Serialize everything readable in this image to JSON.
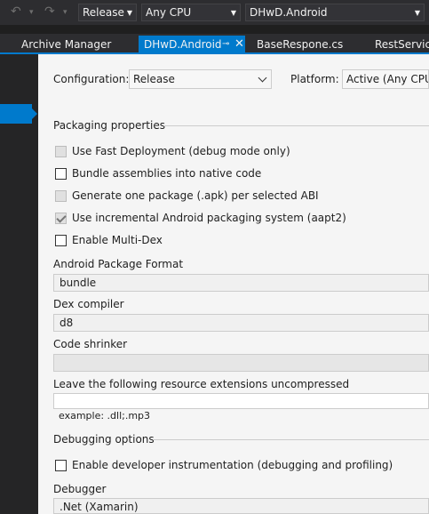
{
  "toolbar": {
    "configuration": "Release",
    "platform": "Any CPU",
    "project": "DHwD.Android"
  },
  "tabs": [
    {
      "label": "Archive Manager"
    },
    {
      "label": "DHwD.Android"
    },
    {
      "label": "BaseRespone.cs"
    },
    {
      "label": "RestService.c"
    }
  ],
  "config": {
    "configuration_label": "Configuration:",
    "configuration_value": "Release",
    "platform_label": "Platform:",
    "platform_value": "Active (Any CPU)"
  },
  "packaging": {
    "title": "Packaging properties",
    "options": [
      {
        "label": "Use Fast Deployment (debug mode only)",
        "checked": false,
        "enabled": false
      },
      {
        "label": "Bundle assemblies into native code",
        "checked": false,
        "enabled": true
      },
      {
        "label": "Generate one package (.apk) per selected ABI",
        "checked": false,
        "enabled": false
      },
      {
        "label": "Use incremental Android packaging system (aapt2)",
        "checked": true,
        "enabled": false
      },
      {
        "label": "Enable Multi-Dex",
        "checked": false,
        "enabled": true
      }
    ],
    "package_format_label": "Android Package Format",
    "package_format_value": "bundle",
    "dex_compiler_label": "Dex compiler",
    "dex_compiler_value": "d8",
    "code_shrinker_label": "Code shrinker",
    "code_shrinker_value": "",
    "uncompressed_label": "Leave the following resource extensions uncompressed",
    "uncompressed_value": "",
    "uncompressed_example": "example: .dll;.mp3"
  },
  "debugging": {
    "title": "Debugging options",
    "instrumentation_label": "Enable developer instrumentation (debugging and profiling)",
    "instrumentation_checked": false,
    "debugger_label": "Debugger",
    "debugger_value": ".Net (Xamarin)"
  }
}
